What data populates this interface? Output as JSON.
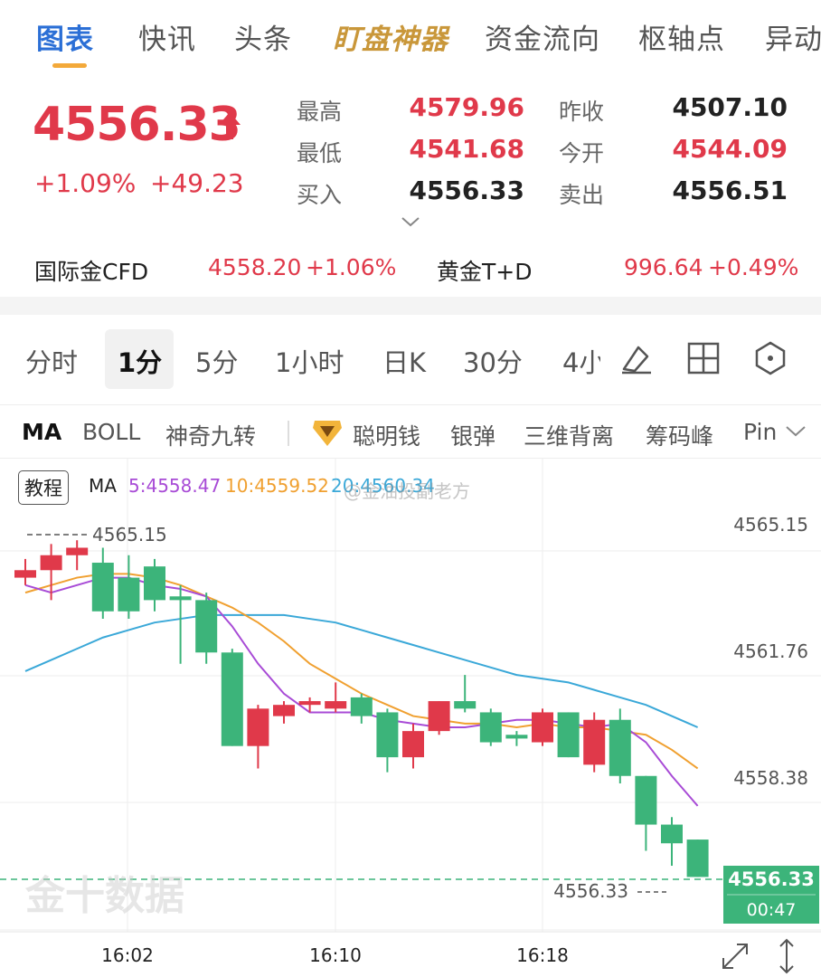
{
  "top_tabs": [
    {
      "label": "图表",
      "active": true
    },
    {
      "label": "快讯"
    },
    {
      "label": "头条"
    },
    {
      "label": "盯盘神器",
      "special": true
    },
    {
      "label": "资金流向"
    },
    {
      "label": "枢轴点"
    },
    {
      "label": "异动"
    }
  ],
  "quote": {
    "price": "4556.33",
    "change_pct": "+1.09%",
    "change_abs": "+49.23",
    "high_label": "最高",
    "high": "4579.96",
    "low_label": "最低",
    "low": "4541.68",
    "bid_label": "买入",
    "bid": "4556.33",
    "prev_close_label": "昨收",
    "prev_close": "4507.10",
    "open_label": "今开",
    "open": "4544.09",
    "ask_label": "卖出",
    "ask": "4556.51"
  },
  "related": [
    {
      "label": "国际金CFD",
      "price": "4558.20",
      "change": "+1.06%"
    },
    {
      "label": "黄金T+D",
      "price": "996.64",
      "change": "+0.49%"
    }
  ],
  "periods": [
    "分时",
    "1分",
    "5分",
    "1小时",
    "日K",
    "30分",
    "4小"
  ],
  "period_active_index": 1,
  "indicators": [
    "MA",
    "BOLL",
    "神奇九转",
    "聪明钱",
    "银弹",
    "三维背离",
    "筹码峰",
    "Pin"
  ],
  "legend": {
    "tutorial": "教程",
    "ma_label": "MA",
    "ma5": "5:4558.47",
    "ma10": "10:4559.52",
    "ma20": "20:4560.34"
  },
  "watermark": "@金油投副老方",
  "logo_watermark": "金十数据",
  "colors": {
    "up": "#e0394a",
    "down": "#3cb47a",
    "ma5": "#a84bd6",
    "ma10": "#f0a030",
    "ma20": "#3aa8d8",
    "accent": "#2b6fd6"
  },
  "chart_data": {
    "type": "candlestick",
    "y_ticks": [
      "4565.15",
      "4561.76",
      "4558.38"
    ],
    "x_ticks": [
      "16:02",
      "16:10",
      "16:18"
    ],
    "ylim": [
      4555.0,
      4567.0
    ],
    "high_marker": "4565.15",
    "low_marker": "4556.33",
    "last_price": "4556.33",
    "countdown": "00:47",
    "candles": [
      {
        "o": 4564.0,
        "c": 4564.2,
        "h": 4564.5,
        "l": 4563.8
      },
      {
        "o": 4564.2,
        "c": 4564.6,
        "h": 4564.9,
        "l": 4563.4
      },
      {
        "o": 4564.6,
        "c": 4564.8,
        "h": 4565.0,
        "l": 4564.2
      },
      {
        "o": 4564.4,
        "c": 4563.1,
        "h": 4564.8,
        "l": 4562.9
      },
      {
        "o": 4564.0,
        "c": 4563.1,
        "h": 4564.6,
        "l": 4562.9
      },
      {
        "o": 4564.3,
        "c": 4563.4,
        "h": 4564.5,
        "l": 4563.1
      },
      {
        "o": 4563.5,
        "c": 4563.4,
        "h": 4563.8,
        "l": 4561.7
      },
      {
        "o": 4563.4,
        "c": 4562.0,
        "h": 4563.6,
        "l": 4561.7
      },
      {
        "o": 4562.0,
        "c": 4559.5,
        "h": 4562.1,
        "l": 4559.5
      },
      {
        "o": 4559.5,
        "c": 4560.5,
        "h": 4560.6,
        "l": 4558.9
      },
      {
        "o": 4560.3,
        "c": 4560.6,
        "h": 4560.7,
        "l": 4560.1
      },
      {
        "o": 4560.6,
        "c": 4560.7,
        "h": 4560.8,
        "l": 4560.4
      },
      {
        "o": 4560.5,
        "c": 4560.7,
        "h": 4561.2,
        "l": 4560.4
      },
      {
        "o": 4560.8,
        "c": 4560.3,
        "h": 4560.9,
        "l": 4560.1
      },
      {
        "o": 4560.4,
        "c": 4559.2,
        "h": 4560.5,
        "l": 4558.8
      },
      {
        "o": 4559.2,
        "c": 4559.9,
        "h": 4560.1,
        "l": 4558.9
      },
      {
        "o": 4559.9,
        "c": 4560.7,
        "h": 4560.7,
        "l": 4559.8
      },
      {
        "o": 4560.7,
        "c": 4560.5,
        "h": 4561.4,
        "l": 4560.4
      },
      {
        "o": 4560.4,
        "c": 4559.6,
        "h": 4560.5,
        "l": 4559.5
      },
      {
        "o": 4559.8,
        "c": 4559.7,
        "h": 4559.9,
        "l": 4559.5
      },
      {
        "o": 4559.6,
        "c": 4560.4,
        "h": 4560.5,
        "l": 4559.5
      },
      {
        "o": 4560.4,
        "c": 4559.2,
        "h": 4560.4,
        "l": 4559.2
      },
      {
        "o": 4559.0,
        "c": 4560.2,
        "h": 4560.4,
        "l": 4558.8
      },
      {
        "o": 4560.2,
        "c": 4558.7,
        "h": 4560.5,
        "l": 4558.5
      },
      {
        "o": 4558.7,
        "c": 4557.4,
        "h": 4558.7,
        "l": 4556.7
      },
      {
        "o": 4557.4,
        "c": 4556.9,
        "h": 4557.6,
        "l": 4556.3
      },
      {
        "o": 4557.0,
        "c": 4556.0,
        "h": 4557.0,
        "l": 4556.0
      }
    ],
    "ma5": [
      4563.8,
      4563.6,
      4563.8,
      4564.0,
      4564.0,
      4563.8,
      4563.7,
      4563.5,
      4562.7,
      4561.7,
      4560.9,
      4560.4,
      4560.4,
      4560.4,
      4560.2,
      4560.1,
      4560.0,
      4560.0,
      4560.1,
      4560.2,
      4560.2,
      4560.1,
      4560.0,
      4560.1,
      4559.6,
      4558.7,
      4557.9
    ],
    "ma10": [
      4563.6,
      4563.8,
      4564.0,
      4564.1,
      4564.1,
      4564.0,
      4563.8,
      4563.5,
      4563.2,
      4562.8,
      4562.3,
      4561.7,
      4561.3,
      4560.9,
      4560.6,
      4560.3,
      4560.2,
      4560.1,
      4560.1,
      4560.0,
      4560.1,
      4560.0,
      4560.0,
      4559.9,
      4559.8,
      4559.4,
      4558.9
    ],
    "ma20": [
      4561.5,
      4561.8,
      4562.1,
      4562.4,
      4562.6,
      4562.8,
      4562.9,
      4563.0,
      4563.0,
      4563.0,
      4563.0,
      4562.9,
      4562.8,
      4562.6,
      4562.4,
      4562.2,
      4562.0,
      4561.8,
      4561.6,
      4561.4,
      4561.3,
      4561.2,
      4561.0,
      4560.8,
      4560.6,
      4560.3,
      4560.0
    ]
  }
}
